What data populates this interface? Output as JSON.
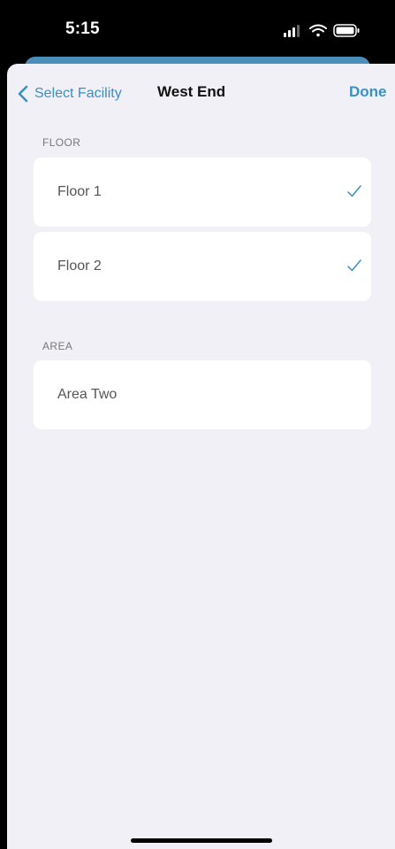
{
  "status_bar": {
    "time": "5:15",
    "icons": [
      "signal-icon",
      "wifi-icon",
      "battery-icon"
    ]
  },
  "nav": {
    "back_label": "Select Facility",
    "title": "West End",
    "done_label": "Done"
  },
  "sections": {
    "floor": {
      "header": "FLOOR",
      "items": [
        {
          "label": "Floor 1",
          "checked": true
        },
        {
          "label": "Floor 2",
          "checked": true
        }
      ]
    },
    "area": {
      "header": "AREA",
      "items": [
        {
          "label": "Area Two",
          "checked": false
        }
      ]
    }
  },
  "colors": {
    "accent": "#3a8fc4",
    "background": "#f1f0f6",
    "cell": "#ffffff",
    "header_peek": "#4a8fba"
  }
}
